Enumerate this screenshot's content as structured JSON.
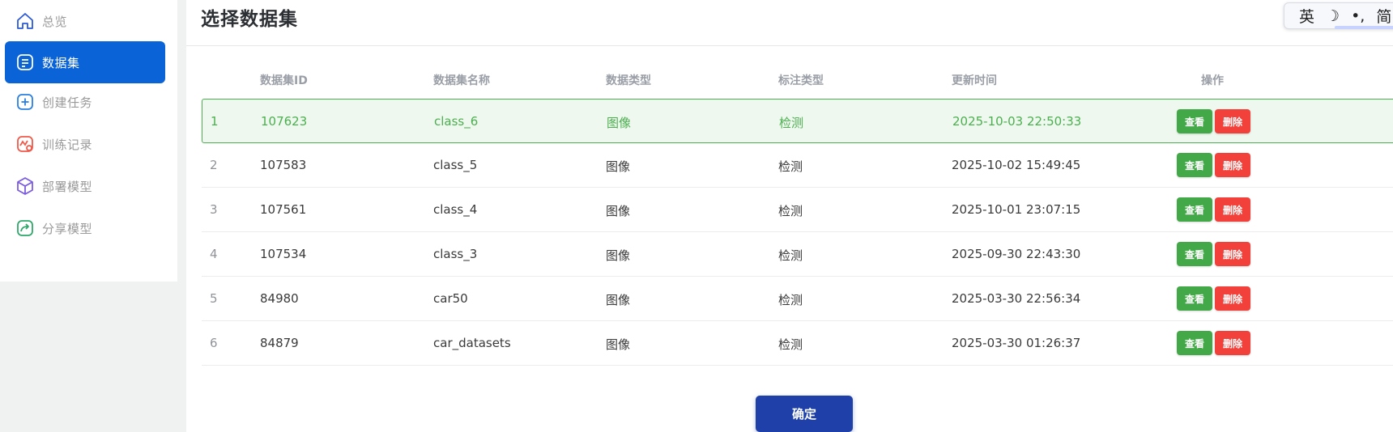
{
  "sidebar": {
    "items": [
      {
        "label": "总览",
        "icon": "home-icon",
        "active": false
      },
      {
        "label": "数据集",
        "icon": "document-icon",
        "active": true
      },
      {
        "label": "创建任务",
        "icon": "plus-square-icon",
        "active": false
      },
      {
        "label": "训练记录",
        "icon": "chart-record-icon",
        "active": false
      },
      {
        "label": "部署模型",
        "icon": "cube-icon",
        "active": false
      },
      {
        "label": "分享模型",
        "icon": "share-icon",
        "active": false
      }
    ]
  },
  "ime": {
    "sep": "|",
    "lang": "英",
    "moon": "☽",
    "punct": "•,",
    "mode": "简"
  },
  "main": {
    "title": "选择数据集",
    "columns": [
      "数据集ID",
      "数据集名称",
      "数据类型",
      "标注类型",
      "更新时间",
      "操作"
    ],
    "rows": [
      {
        "index": "1",
        "id": "107623",
        "name": "class_6",
        "data_type": "图像",
        "label_type": "检测",
        "updated": "2025-10-03 22:50:33",
        "selected": true
      },
      {
        "index": "2",
        "id": "107583",
        "name": "class_5",
        "data_type": "图像",
        "label_type": "检测",
        "updated": "2025-10-02 15:49:45",
        "selected": false
      },
      {
        "index": "3",
        "id": "107561",
        "name": "class_4",
        "data_type": "图像",
        "label_type": "检测",
        "updated": "2025-10-01 23:07:15",
        "selected": false
      },
      {
        "index": "4",
        "id": "107534",
        "name": "class_3",
        "data_type": "图像",
        "label_type": "检测",
        "updated": "2025-09-30 22:43:30",
        "selected": false
      },
      {
        "index": "5",
        "id": "84980",
        "name": "car50",
        "data_type": "图像",
        "label_type": "检测",
        "updated": "2025-03-30 22:56:34",
        "selected": false
      },
      {
        "index": "6",
        "id": "84879",
        "name": "car_datasets",
        "data_type": "图像",
        "label_type": "检测",
        "updated": "2025-03-30 01:26:37",
        "selected": false
      }
    ],
    "view_label": "查看",
    "delete_label": "删除",
    "confirm_label": "确定"
  },
  "colors": {
    "accent": "#0b63d8",
    "view": "#43a847",
    "delete": "#f2413a",
    "confirm": "#1e40a8",
    "selected_text": "#4caf50"
  }
}
